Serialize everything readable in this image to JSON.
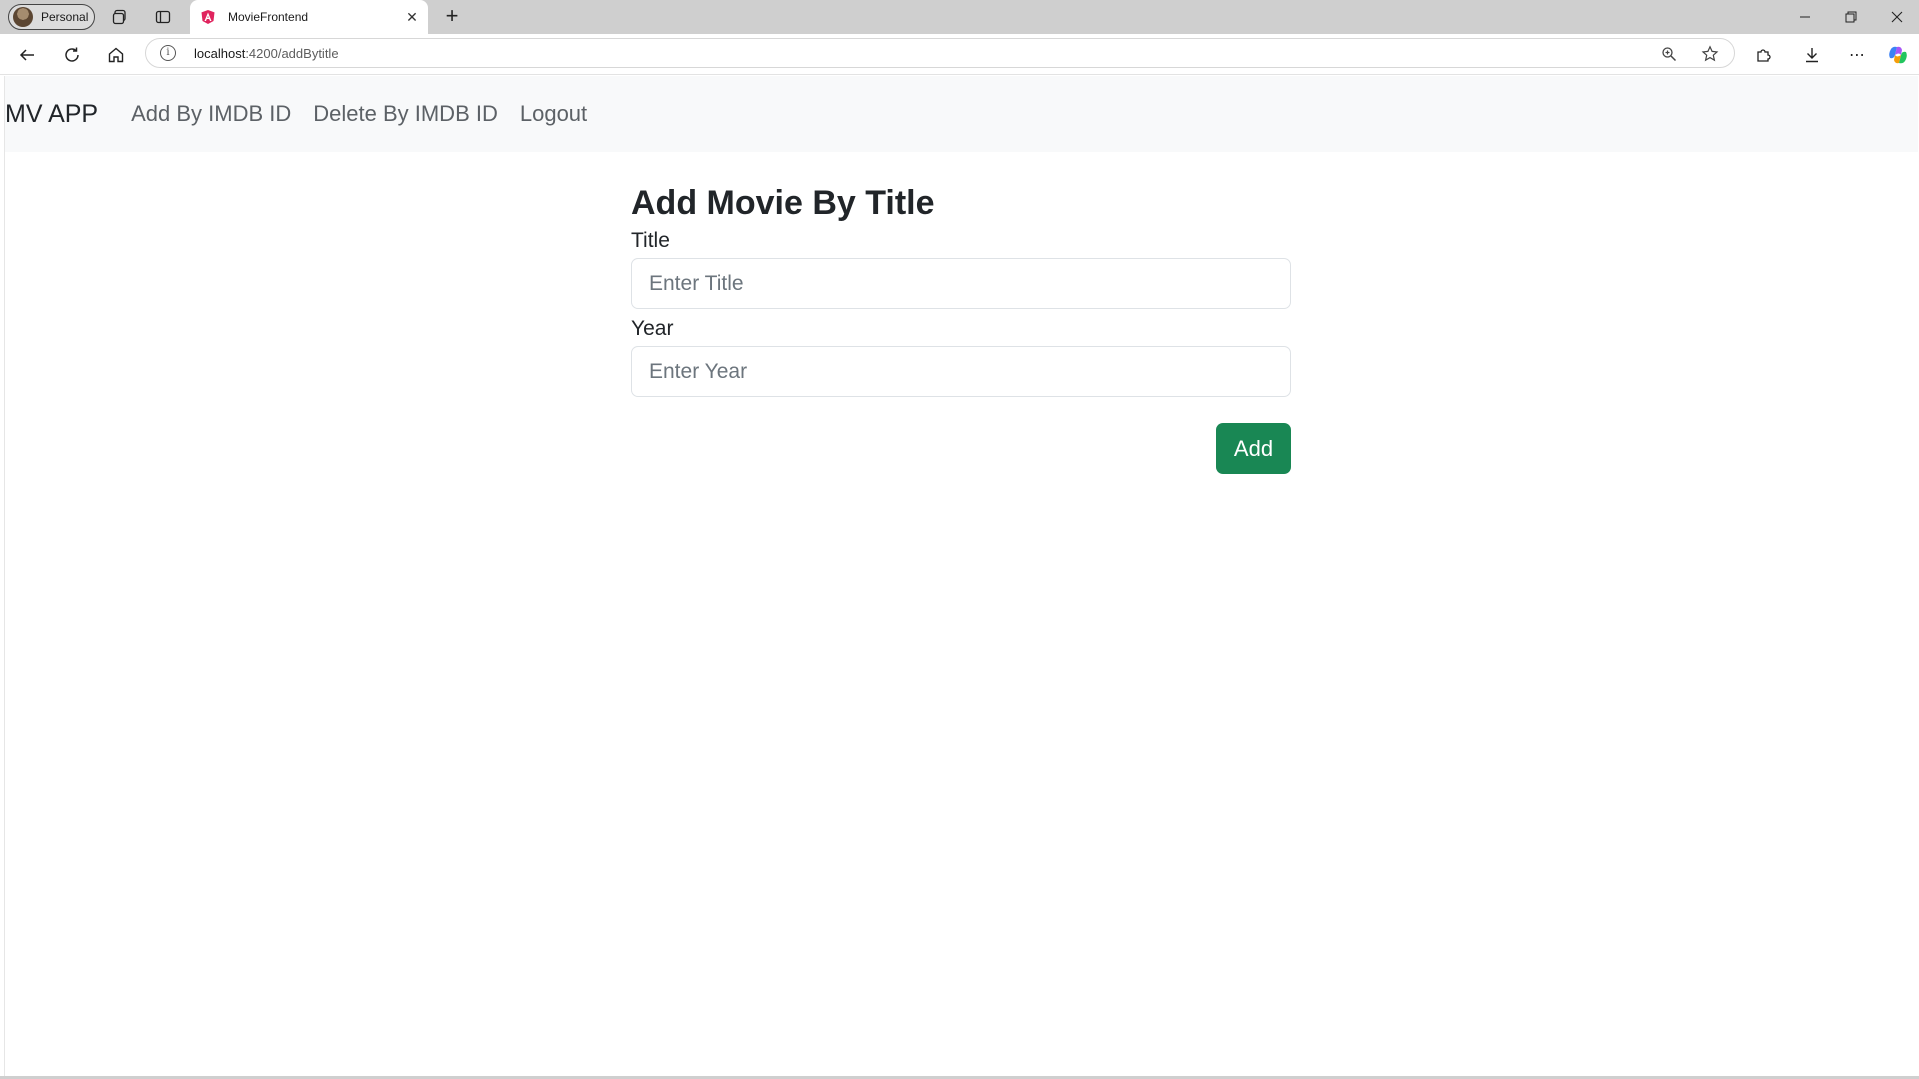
{
  "browser": {
    "profile_label": "Personal",
    "tab_title": "MovieFrontend",
    "url_host": "localhost",
    "url_path": ":4200/addBytitle",
    "icons": [
      "workspaces-icon",
      "tab-actions-icon",
      "angular-favicon",
      "close-tab-icon",
      "new-tab-icon",
      "minimize-icon",
      "restore-icon",
      "close-window-icon",
      "back-icon",
      "refresh-icon",
      "home-icon",
      "site-info-icon",
      "zoom-icon",
      "favorite-star-icon",
      "extensions-icon",
      "downloads-icon",
      "more-icon",
      "copilot-icon"
    ]
  },
  "navbar": {
    "brand": "MV APP",
    "links": [
      "Add By IMDB ID",
      "Delete By IMDB ID",
      "Logout"
    ]
  },
  "form": {
    "heading": "Add Movie By Title",
    "title_label": "Title",
    "title_placeholder": "Enter Title",
    "year_label": "Year",
    "year_placeholder": "Enter Year",
    "submit_label": "Add"
  },
  "colors": {
    "button_success": "#198754",
    "navbar_bg": "#f8f9fa",
    "tabstrip_bg": "#cfcfcf"
  }
}
